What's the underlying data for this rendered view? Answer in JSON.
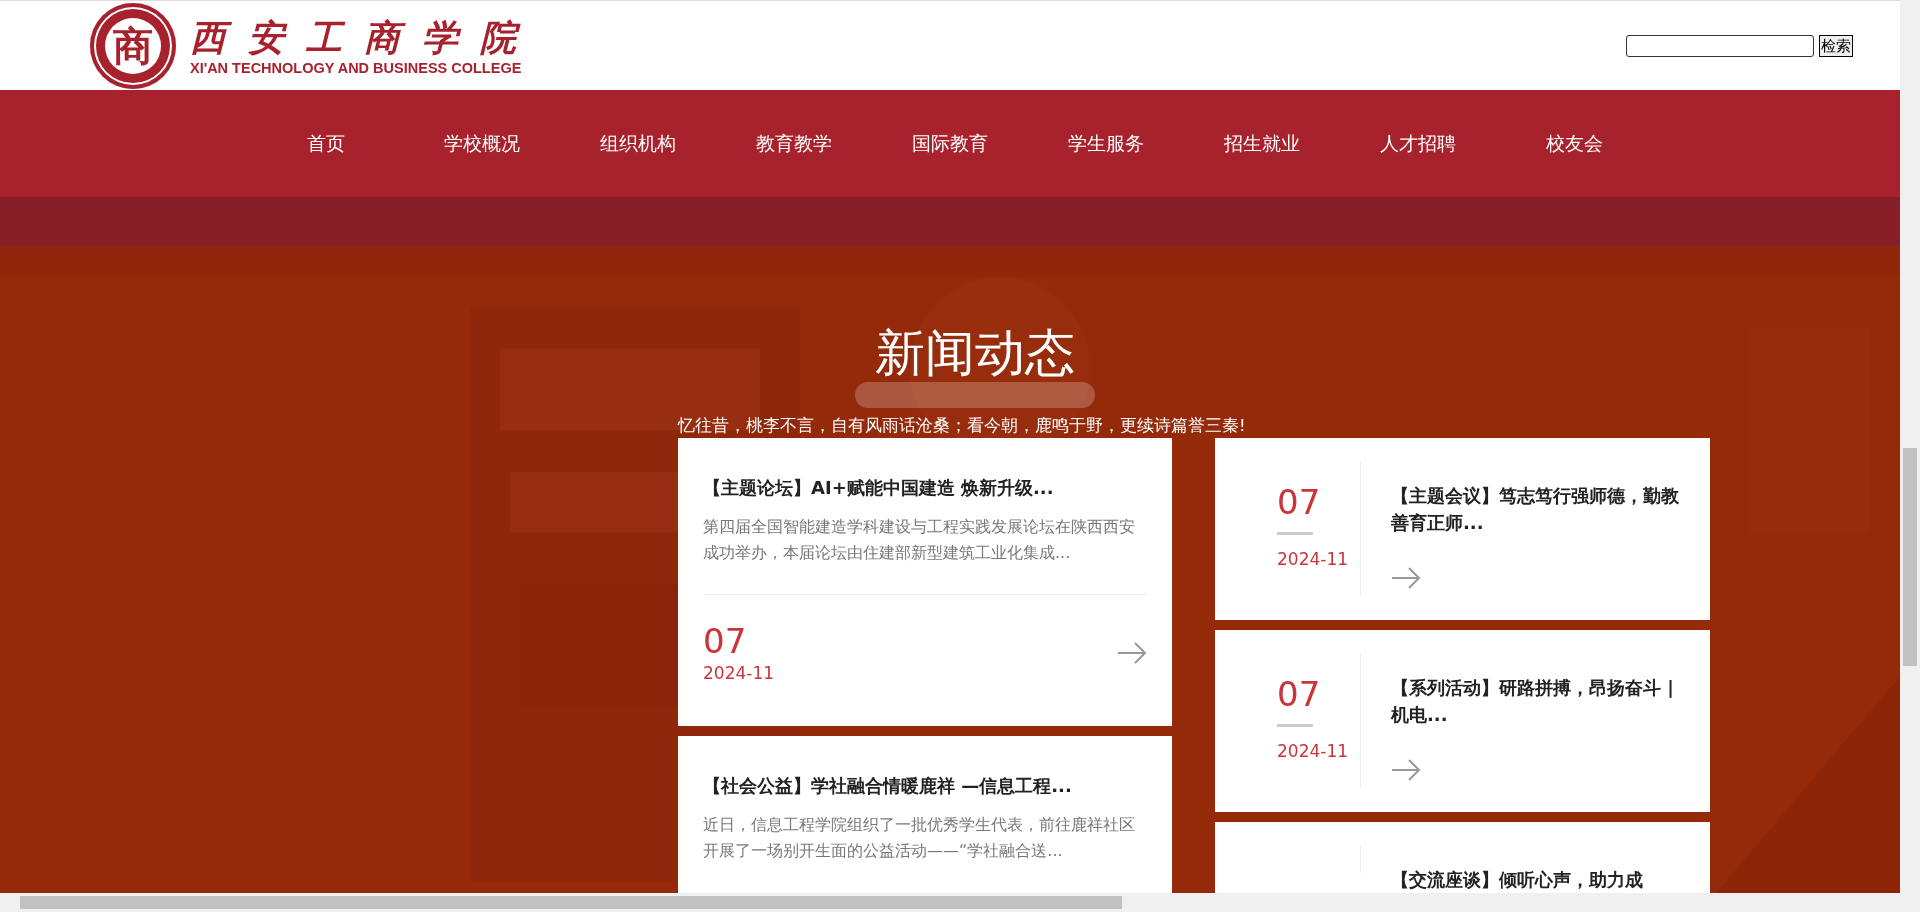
{
  "header": {
    "emblem_char": "商",
    "logo_cn": "西安工商学院",
    "logo_en": "XI'AN TECHNOLOGY AND BUSINESS COLLEGE",
    "search_button": "检索"
  },
  "nav": [
    {
      "label": "首页"
    },
    {
      "label": "学校概况"
    },
    {
      "label": "组织机构"
    },
    {
      "label": "教育教学"
    },
    {
      "label": "国际教育"
    },
    {
      "label": "学生服务"
    },
    {
      "label": "招生就业"
    },
    {
      "label": "人才招聘"
    },
    {
      "label": "校友会"
    }
  ],
  "news": {
    "title": "新闻动态",
    "subtitle": "忆往昔，桃李不言，自有风雨话沧桑；看今朝，鹿鸣于野，更续诗篇誉三秦!",
    "featured": [
      {
        "title": "【主题论坛】AI+赋能中国建造 焕新升级...",
        "summary": "第四届全国智能建造学科建设与工程实践发展论坛在陕西西安成功举办，本届论坛由住建部新型建筑工业化集成...",
        "day": "07",
        "month": "2024-11"
      },
      {
        "title": "【社会公益】学社融合情暖鹿祥 —信息工程...",
        "summary": "近日，信息工程学院组织了一批优秀学生代表，前往鹿祥社区开展了一场别开生面的公益活动——“学社融合送..."
      }
    ],
    "list": [
      {
        "day": "07",
        "month": "2024-11",
        "title": "【主题会议】笃志笃行强师德，勤教善育正师..."
      },
      {
        "day": "07",
        "month": "2024-11",
        "title": "【系列活动】研路拼搏，昂扬奋斗 | 机电..."
      },
      {
        "title": "【交流座谈】倾听心声，助力成"
      }
    ]
  }
}
